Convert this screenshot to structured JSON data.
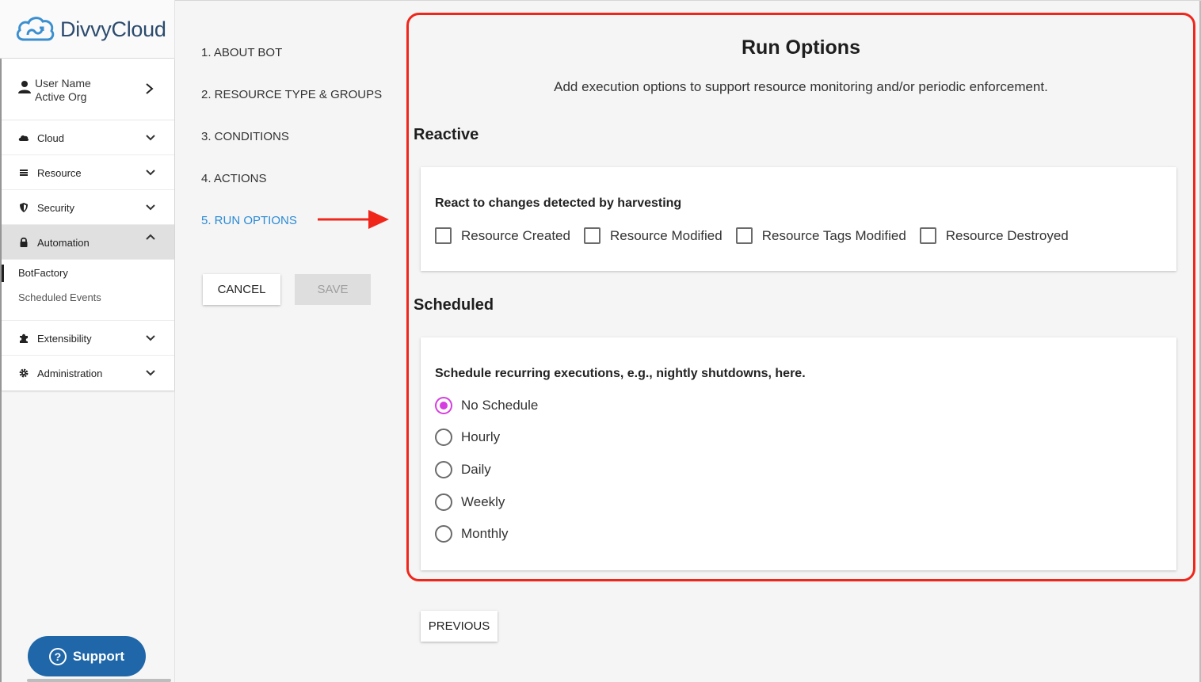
{
  "app": {
    "logo_text": "DivvyCloud"
  },
  "user": {
    "name": "User Name",
    "org": "Active Org"
  },
  "nav": {
    "items": [
      {
        "label": "Cloud",
        "icon": "cloud-icon"
      },
      {
        "label": "Resource",
        "icon": "list-icon"
      },
      {
        "label": "Security",
        "icon": "shield-icon"
      },
      {
        "label": "Automation",
        "icon": "lock-icon"
      },
      {
        "label": "Extensibility",
        "icon": "puzzle-icon"
      },
      {
        "label": "Administration",
        "icon": "gear-icon"
      }
    ],
    "automation_sub": [
      "BotFactory",
      "Scheduled Events"
    ]
  },
  "support": {
    "label": "Support"
  },
  "steps": [
    "1. ABOUT BOT",
    "2. RESOURCE TYPE & GROUPS",
    "3. CONDITIONS",
    "4. ACTIONS",
    "5. RUN OPTIONS"
  ],
  "buttons": {
    "cancel": "CANCEL",
    "save": "SAVE",
    "previous": "PREVIOUS"
  },
  "panel": {
    "title": "Run Options",
    "subtitle": "Add execution options to support resource monitoring and/or periodic enforcement.",
    "reactive": {
      "heading": "Reactive",
      "card_heading": "React to changes detected by harvesting",
      "options": [
        "Resource Created",
        "Resource Modified",
        "Resource Tags Modified",
        "Resource Destroyed"
      ]
    },
    "scheduled": {
      "heading": "Scheduled",
      "card_heading": "Schedule recurring executions, e.g., nightly shutdowns, here.",
      "options": [
        "No Schedule",
        "Hourly",
        "Daily",
        "Weekly",
        "Monthly"
      ],
      "selected": "No Schedule"
    }
  },
  "colors": {
    "accent_blue": "#2b8bd6",
    "highlight_red": "#f0261b",
    "radio_selected": "#d63de0",
    "support_blue": "#1f67a8"
  }
}
